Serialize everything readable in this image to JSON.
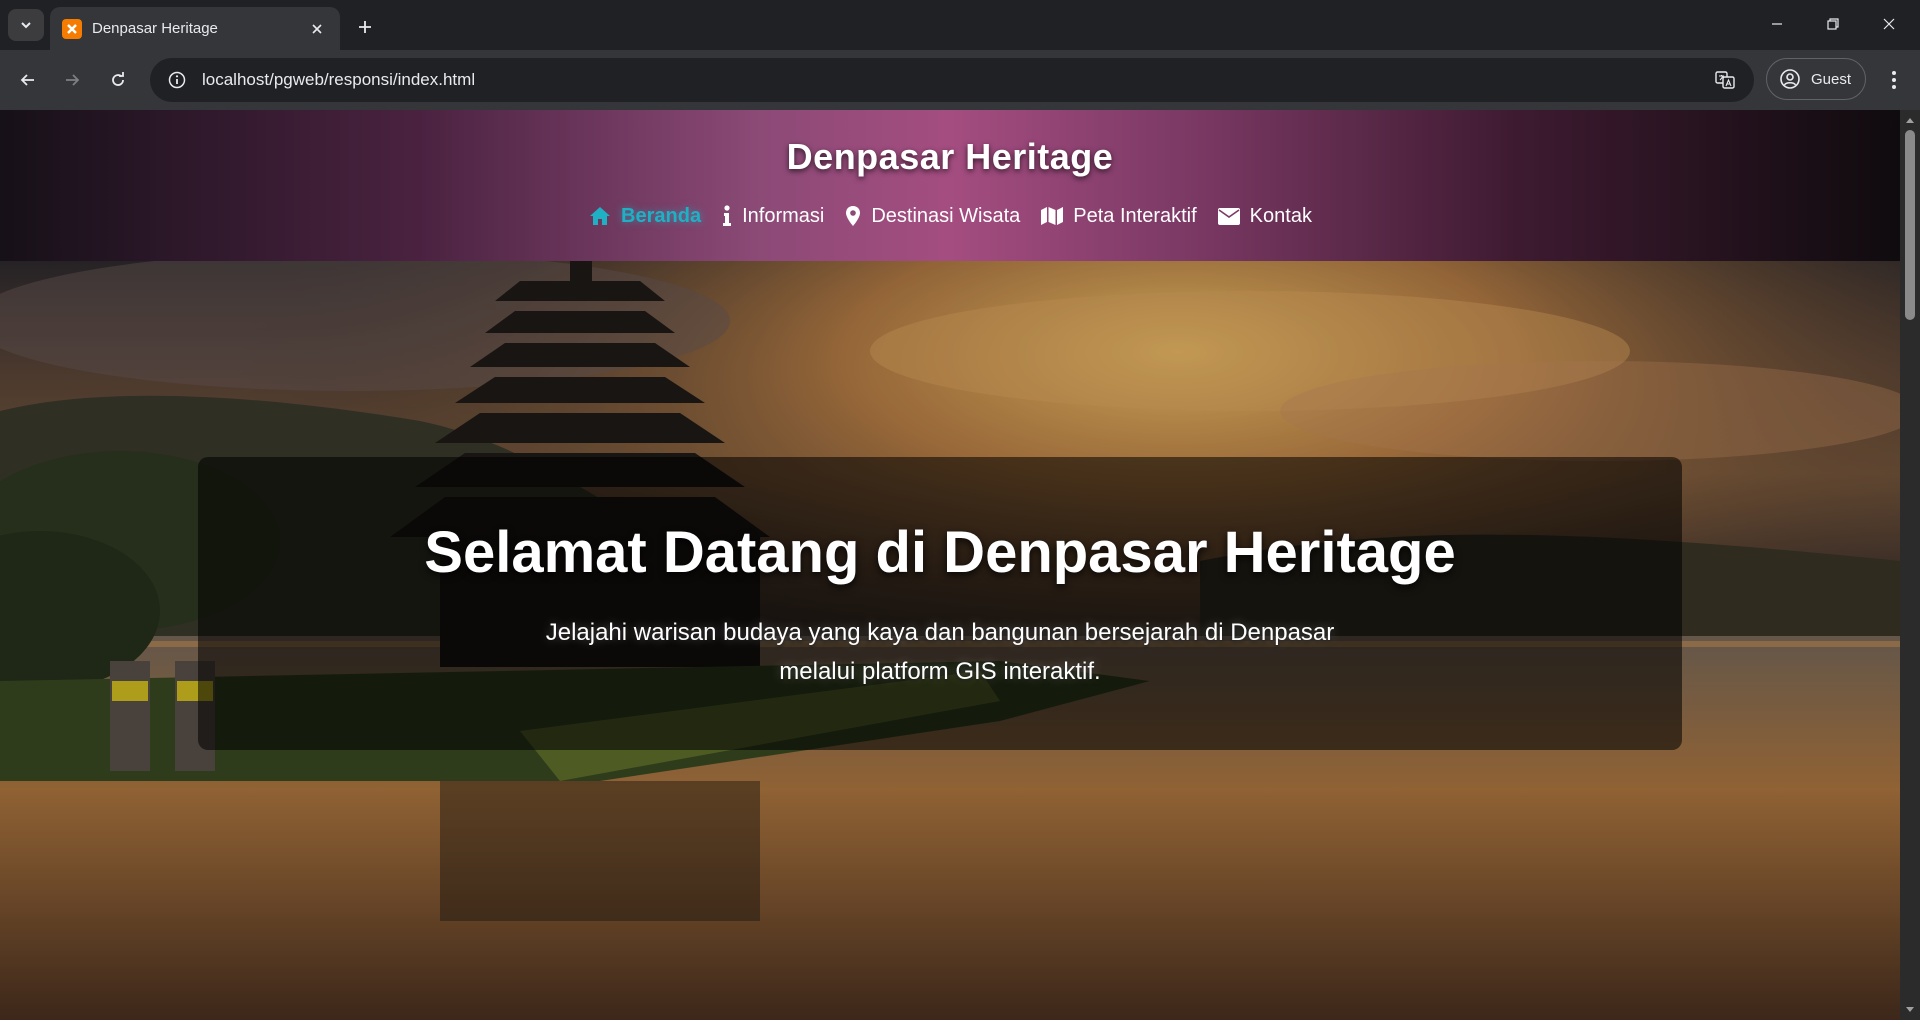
{
  "browser": {
    "tab_title": "Denpasar Heritage",
    "url": "localhost/pgweb/responsi/index.html",
    "profile_label": "Guest"
  },
  "site": {
    "title": "Denpasar Heritage",
    "nav": [
      {
        "label": "Beranda",
        "icon": "home-icon",
        "active": true
      },
      {
        "label": "Informasi",
        "icon": "info-icon",
        "active": false
      },
      {
        "label": "Destinasi Wisata",
        "icon": "map-pin-icon",
        "active": false
      },
      {
        "label": "Peta Interaktif",
        "icon": "map-icon",
        "active": false
      },
      {
        "label": "Kontak",
        "icon": "envelope-icon",
        "active": false
      }
    ],
    "accent_color": "#1fb0c4"
  },
  "hero": {
    "title": "Selamat Datang di Denpasar Heritage",
    "subtitle": "Jelajahi warisan budaya yang kaya dan bangunan bersejarah di Denpasar melalui platform GIS interaktif."
  }
}
